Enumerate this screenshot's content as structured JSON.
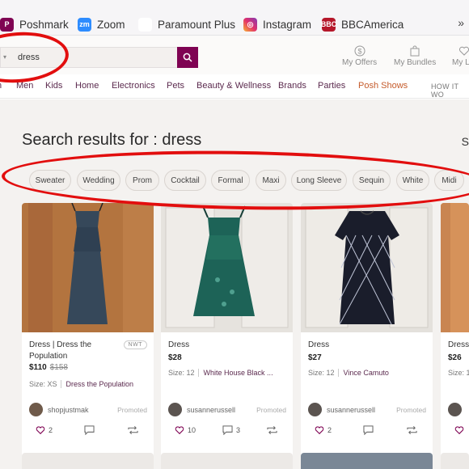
{
  "bookmarks": [
    {
      "label": "Poshmark",
      "icon": "poshmark-icon",
      "glyph": "P"
    },
    {
      "label": "Zoom",
      "icon": "zoom-icon",
      "glyph": "zm"
    },
    {
      "label": "Paramount Plus",
      "icon": "paramount-icon",
      "glyph": "▲"
    },
    {
      "label": "Instagram",
      "icon": "instagram-icon",
      "glyph": "◎"
    },
    {
      "label": "BBCAmerica",
      "icon": "bbc-america-icon",
      "glyph": "BBC"
    }
  ],
  "bookmarks_more": "»",
  "search": {
    "value": "dress",
    "dropdown_glyph": "▾"
  },
  "header_links": {
    "offers": "My Offers",
    "bundles": "My Bundles",
    "likes": "My L"
  },
  "categories": [
    "Men",
    "Kids",
    "Home",
    "Electronics",
    "Pets",
    "Beauty & Wellness",
    "Brands",
    "Parties",
    "Posh Shows"
  ],
  "how_it_works": "HOW IT WO",
  "results": {
    "title": "Search results for : dress",
    "right_cut": "S"
  },
  "chips": [
    "Sweater",
    "Wedding",
    "Prom",
    "Cocktail",
    "Formal",
    "Maxi",
    "Long Sleeve",
    "Sequin",
    "White",
    "Midi"
  ],
  "products": [
    {
      "title": "Dress | Dress the Population",
      "badge": "NWT",
      "price": "$110",
      "original_price": "$158",
      "size": "Size: XS",
      "brand": "Dress the Population",
      "seller": "shopjustmak",
      "promo": "Promoted",
      "likes": "2",
      "comments": "",
      "shares": ""
    },
    {
      "title": "Dress",
      "badge": "",
      "price": "$28",
      "original_price": "",
      "size": "Size: 12",
      "brand": "White House Black ...",
      "seller": "susannerussell",
      "promo": "Promoted",
      "likes": "10",
      "comments": "3",
      "shares": ""
    },
    {
      "title": "Dress",
      "badge": "",
      "price": "$27",
      "original_price": "",
      "size": "Size: 12",
      "brand": "Vince Camuto",
      "seller": "susannerussell",
      "promo": "Promoted",
      "likes": "2",
      "comments": "",
      "shares": ""
    },
    {
      "title": "Dress",
      "badge": "",
      "price": "$26",
      "original_price": "",
      "size": "Size: 1",
      "brand": "",
      "seller": "",
      "promo": "",
      "likes": "",
      "comments": "",
      "shares": ""
    }
  ],
  "colors": {
    "brand": "#7f0353",
    "annotation": "#e20e0e",
    "posh_shows": "#c55b2b"
  }
}
